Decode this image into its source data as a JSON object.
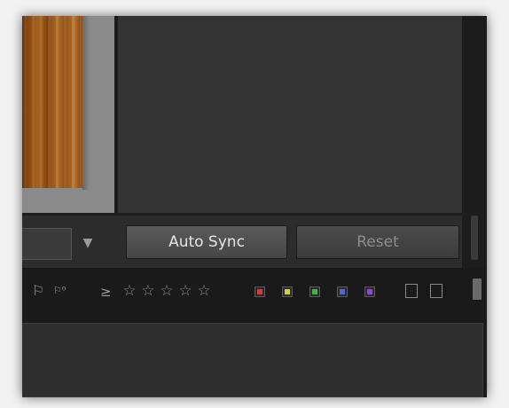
{
  "sync_panel": {
    "auto_sync_label": "Auto Sync",
    "reset_label": "Reset"
  },
  "filter_bar": {
    "flag_icons": [
      "flag-outline-icon",
      "flag-rejected-icon"
    ],
    "rating_operator": "≥",
    "stars": [
      "☆",
      "☆",
      "☆",
      "☆",
      "☆"
    ],
    "color_labels": [
      "#d83a3a",
      "#d8d23a",
      "#3ab64a",
      "#4a6ad8",
      "#8a4ad8"
    ]
  }
}
